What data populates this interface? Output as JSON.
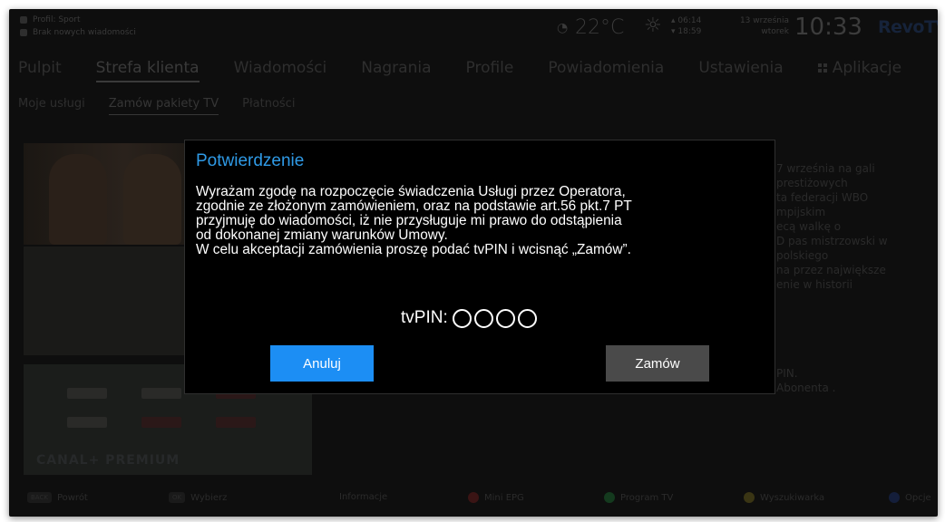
{
  "status": {
    "profile": "Profil: Sport",
    "messages": "Brak nowych wiadomości",
    "temperature": "22°C",
    "sunrise": "06:14",
    "sunset": "18:59",
    "date": "13 września",
    "weekday": "wtorek",
    "clock": "10:33",
    "brand": "RevoTV"
  },
  "main_nav": {
    "items": [
      "Pulpit",
      "Strefa klienta",
      "Wiadomości",
      "Nagrania",
      "Profile",
      "Powiadomienia",
      "Ustawienia",
      "Aplikacje"
    ],
    "active": "Strefa klienta"
  },
  "sub_nav": {
    "items": [
      "Moje usługi",
      "Zamów pakiety TV",
      "Płatności"
    ],
    "active": "Zamów pakiety TV"
  },
  "background": {
    "package_label": "CANAL+ PREMIUM",
    "description_lines": [
      "7 września na gali",
      "prestiżowych",
      "ta federacji WBO",
      "mpijskim",
      "ecą walkę o",
      "D pas mistrzowski w",
      "polskiego",
      "na przez największe",
      "enie w historii"
    ],
    "note_lines": [
      "PIN.",
      "Abonenta ."
    ]
  },
  "modal": {
    "title": "Potwierdzenie",
    "body_lines": [
      "Wyrażam zgodę na rozpoczęcie świadczenia Usługi przez Operatora,",
      "zgodnie ze złożonym zamówieniem, oraz na podstawie art.56 pkt.7 PT",
      "przyjmuję do wiadomości, iż nie przysługuje mi prawo do odstąpienia",
      "od dokonanej zmiany warunków Umowy.",
      "W celu akceptacji zamówienia proszę podać tvPIN i wcisnąć „Zamów”."
    ],
    "pin_label": "tvPIN:",
    "pin_length": 4,
    "cancel_label": "Anuluj",
    "order_label": "Zamów"
  },
  "bottom_bar": {
    "back_key": "BACK",
    "back_label": "Powrót",
    "ok_key": "OK",
    "ok_label": "Wybierz",
    "info_label": "Informacje",
    "red_label": "Mini EPG",
    "green_label": "Program TV",
    "yellow_label": "Wyszukiwarka",
    "blue_label": "Opcje",
    "colors": {
      "red": "#3a1414",
      "green": "#143a1e",
      "yellow": "#3a3514",
      "blue": "#141e3a"
    }
  },
  "colors": {
    "accent_title": "#2f9ae6",
    "button_primary": "#1c8ef4",
    "button_secondary": "#4a4a4a",
    "modal_bg": "#000000"
  }
}
